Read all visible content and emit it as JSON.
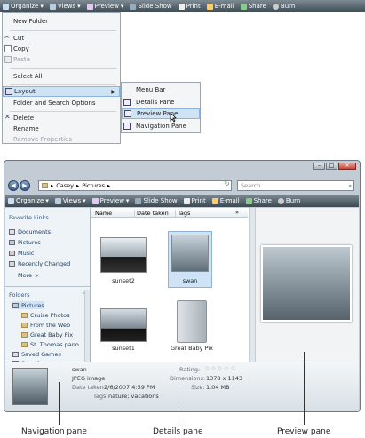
{
  "top": {
    "toolbar": [
      "Organize",
      "Views",
      "Preview",
      "Slide Show",
      "Print",
      "E-mail",
      "Share",
      "Burn"
    ],
    "menu": {
      "new_folder": "New Folder",
      "cut": "Cut",
      "copy": "Copy",
      "paste": "Paste",
      "select_all": "Select All",
      "layout": "Layout",
      "folder_search_options": "Folder and Search Options",
      "delete": "Delete",
      "rename": "Rename",
      "remove_properties": "Remove Properties"
    },
    "submenu": {
      "menu_bar": "Menu Bar",
      "details_pane": "Details Pane",
      "preview_pane": "Preview Pane",
      "navigation_pane": "Navigation Pane"
    }
  },
  "window": {
    "breadcrumb": [
      "Casey",
      "Pictures"
    ],
    "search_placeholder": "Search",
    "toolbar": [
      "Organize",
      "Views",
      "Preview",
      "Slide Show",
      "Print",
      "E-mail",
      "Share",
      "Burn"
    ],
    "favorite_links_heading": "Favorite Links",
    "favorites": [
      "Documents",
      "Pictures",
      "Music",
      "Recently Changed"
    ],
    "more": "More",
    "more_chevron": "»",
    "folders_heading": "Folders",
    "folders": [
      "Pictures",
      "Cruise Photos",
      "From the Web",
      "Great Baby Pix",
      "St. Thomas pano",
      "Saved Games",
      "Searches"
    ],
    "columns": [
      "Name",
      "Date taken",
      "Tags"
    ],
    "col_more": "»",
    "files": [
      "sunset2",
      "swan",
      "sunset1",
      "Great Baby Pix"
    ],
    "details": {
      "name": "swan",
      "type": "JPEG image",
      "date_label": "Date taken:",
      "date_value": "2/6/2007 4:59 PM",
      "tags_label": "Tags:",
      "tags_value": "nature; vacations",
      "rating_label": "Rating:",
      "dimensions_label": "Dimensions:",
      "dimensions_value": "1378 x 1143",
      "size_label": "Size:",
      "size_value": "1.04 MB"
    }
  },
  "captions": {
    "navigation": "Navigation pane",
    "details": "Details pane",
    "preview": "Preview pane"
  },
  "colors": {
    "toolbar_top": "#7e8a93",
    "toolbar_bottom": "#3c4a54",
    "menu_bg": "#f4f5f7",
    "highlight": "#cfe3f7"
  }
}
